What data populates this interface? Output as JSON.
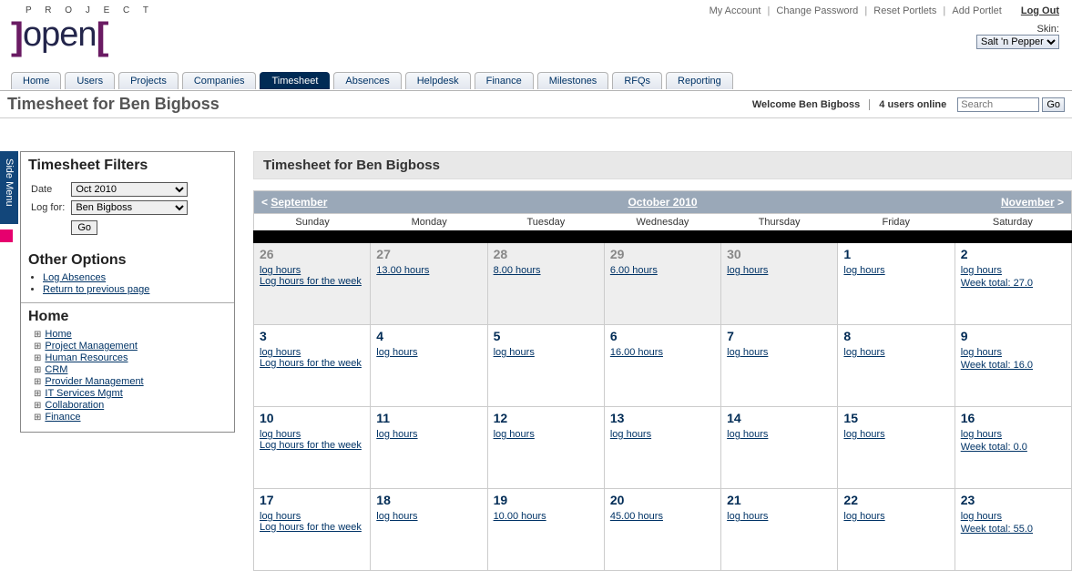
{
  "header": {
    "links": [
      "My Account",
      "Change Password",
      "Reset Portlets",
      "Add Portlet"
    ],
    "logout": "Log Out",
    "skin_label": "Skin:",
    "skin_value": "Salt 'n Pepper",
    "logo_top": "P R O J E C T",
    "logo_main": "open"
  },
  "tabs": [
    "Home",
    "Users",
    "Projects",
    "Companies",
    "Timesheet",
    "Absences",
    "Helpdesk",
    "Finance",
    "Milestones",
    "RFQs",
    "Reporting"
  ],
  "tabs_active_index": 4,
  "page_title": "Timesheet for Ben Bigboss",
  "welcome": "Welcome Ben Bigboss",
  "users_online": "4 users online",
  "search_placeholder": "Search",
  "search_go": "Go",
  "side_menu_label": "Side Menu",
  "sidebar": {
    "filters_title": "Timesheet Filters",
    "date_label": "Date",
    "date_value": "Oct 2010",
    "logfor_label": "Log for:",
    "logfor_value": "Ben Bigboss",
    "go": "Go",
    "other_title": "Other Options",
    "other_links": [
      "Log Absences",
      "Return to previous page"
    ],
    "home_title": "Home",
    "tree": [
      "Home",
      "Project Management",
      "Human Resources",
      "CRM",
      "Provider Management",
      "IT Services Mgmt",
      "Collaboration",
      "Finance"
    ]
  },
  "main": {
    "panel_title": "Timesheet for Ben Bigboss",
    "prev_month": "September",
    "prev_arrow": "<",
    "current_month": "October 2010",
    "next_month": "November",
    "next_arrow": ">",
    "weekdays": [
      "Sunday",
      "Monday",
      "Tuesday",
      "Wednesday",
      "Thursday",
      "Friday",
      "Saturday"
    ],
    "log_hours": "log hours",
    "log_week": "Log hours for the week",
    "cells": [
      {
        "day": "26",
        "prev": true,
        "sunday": true,
        "hours": null,
        "week_total": null
      },
      {
        "day": "27",
        "prev": true,
        "hours": "13.00 hours"
      },
      {
        "day": "28",
        "prev": true,
        "hours": "8.00 hours"
      },
      {
        "day": "29",
        "prev": true,
        "hours": "6.00 hours"
      },
      {
        "day": "30",
        "prev": true,
        "hours": null
      },
      {
        "day": "1",
        "hours": null
      },
      {
        "day": "2",
        "hours": null,
        "week_total": "Week total: 27.0"
      },
      {
        "day": "3",
        "sunday": true,
        "hours": null
      },
      {
        "day": "4",
        "hours": null
      },
      {
        "day": "5",
        "hours": null
      },
      {
        "day": "6",
        "hours": "16.00 hours"
      },
      {
        "day": "7",
        "hours": null
      },
      {
        "day": "8",
        "hours": null
      },
      {
        "day": "9",
        "hours": null,
        "week_total": "Week total: 16.0"
      },
      {
        "day": "10",
        "sunday": true,
        "hours": null
      },
      {
        "day": "11",
        "hours": null
      },
      {
        "day": "12",
        "hours": null
      },
      {
        "day": "13",
        "hours": null
      },
      {
        "day": "14",
        "hours": null
      },
      {
        "day": "15",
        "hours": null
      },
      {
        "day": "16",
        "hours": null,
        "week_total": "Week total: 0.0"
      },
      {
        "day": "17",
        "sunday": true,
        "hours": null
      },
      {
        "day": "18",
        "hours": null
      },
      {
        "day": "19",
        "hours": "10.00 hours"
      },
      {
        "day": "20",
        "hours": "45.00 hours"
      },
      {
        "day": "21",
        "hours": null
      },
      {
        "day": "22",
        "hours": null
      },
      {
        "day": "23",
        "hours": null,
        "week_total": "Week total: 55.0"
      }
    ]
  }
}
